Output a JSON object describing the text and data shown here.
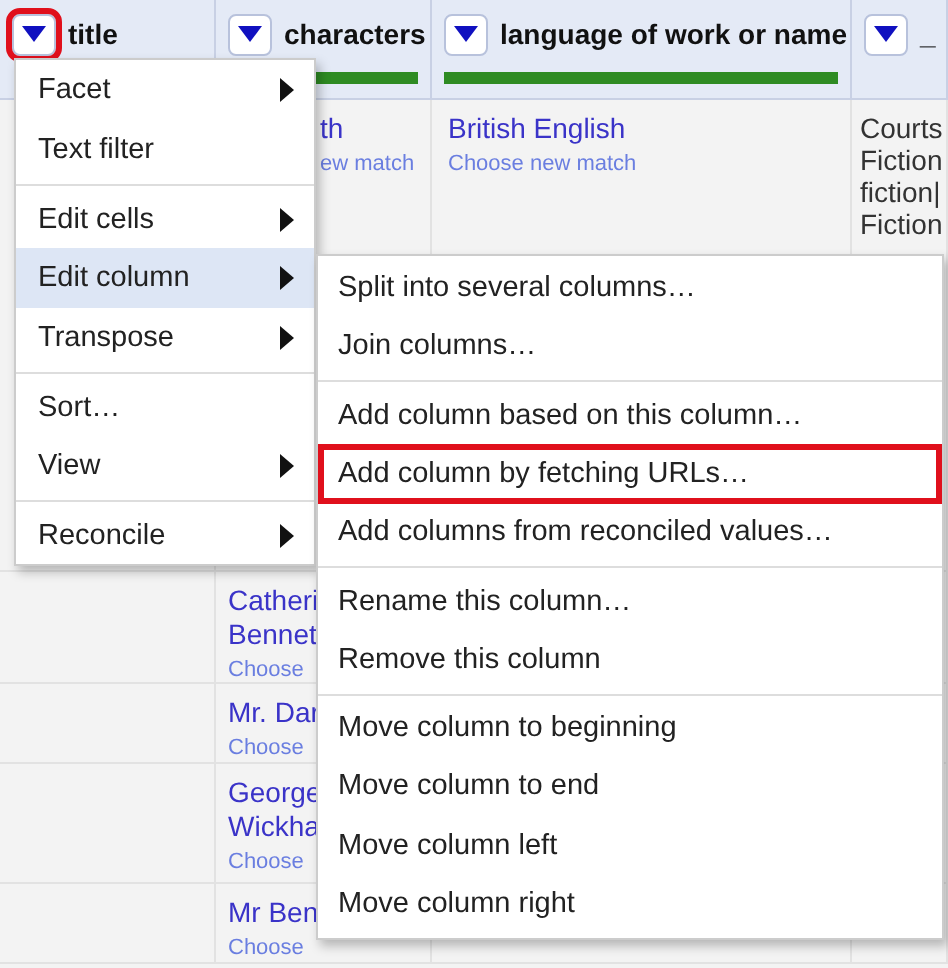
{
  "columns": [
    {
      "name": "title",
      "highlighted": true
    },
    {
      "name": "characters",
      "highlighted": false,
      "reconciled": true
    },
    {
      "name": "language of work or name",
      "highlighted": false,
      "reconciled": true
    },
    {
      "name": "_",
      "highlighted": false,
      "reconciled": false
    }
  ],
  "rows": [
    {
      "cells": [
        null,
        {
          "lines": [
            "th"
          ],
          "match": "ew match"
        },
        {
          "lines": [
            "British English"
          ],
          "match": "Choose new match"
        },
        {
          "lines": [
            "Courts",
            "Fiction",
            "fiction|",
            "Fiction"
          ]
        }
      ]
    },
    {
      "cells": [
        null,
        {
          "lines": [
            "Catheri",
            "Bennet"
          ],
          "match": "Choose"
        },
        null,
        null
      ]
    },
    {
      "cells": [
        null,
        {
          "lines": [
            "Mr. Dar"
          ],
          "match": "Choose"
        },
        null,
        null
      ]
    },
    {
      "cells": [
        null,
        {
          "lines": [
            "George",
            "Wickha"
          ],
          "match": "Choose"
        },
        null,
        null
      ]
    },
    {
      "cells": [
        null,
        {
          "lines": [
            "Mr Ben"
          ],
          "match": "Choose"
        },
        null,
        null
      ]
    }
  ],
  "menu": {
    "items": [
      {
        "label": "Facet",
        "submenu": true,
        "selected": false
      },
      {
        "label": "Text filter",
        "submenu": false,
        "selected": false
      },
      {
        "label": "Edit cells",
        "submenu": true,
        "selected": false,
        "separator_before": true
      },
      {
        "label": "Edit column",
        "submenu": true,
        "selected": true
      },
      {
        "label": "Transpose",
        "submenu": true,
        "selected": false
      },
      {
        "label": "Sort…",
        "submenu": false,
        "selected": false,
        "separator_before": true
      },
      {
        "label": "View",
        "submenu": true,
        "selected": false
      },
      {
        "label": "Reconcile",
        "submenu": true,
        "selected": false,
        "separator_before": true
      }
    ]
  },
  "submenu": {
    "items": [
      {
        "label": "Split into several columns…",
        "highlighted": false
      },
      {
        "label": "Join columns…",
        "highlighted": false
      },
      {
        "label": "Add column based on this column…",
        "highlighted": false,
        "separator_before": true
      },
      {
        "label": "Add column by fetching URLs…",
        "highlighted": true
      },
      {
        "label": "Add columns from reconciled values…",
        "highlighted": false
      },
      {
        "label": "Rename this column…",
        "highlighted": false,
        "separator_before": true
      },
      {
        "label": "Remove this column",
        "highlighted": false
      },
      {
        "label": "Move column to beginning",
        "highlighted": false,
        "separator_before": true
      },
      {
        "label": "Move column to end",
        "highlighted": false
      },
      {
        "label": "Move column left",
        "highlighted": false
      },
      {
        "label": "Move column right",
        "highlighted": false
      }
    ]
  }
}
